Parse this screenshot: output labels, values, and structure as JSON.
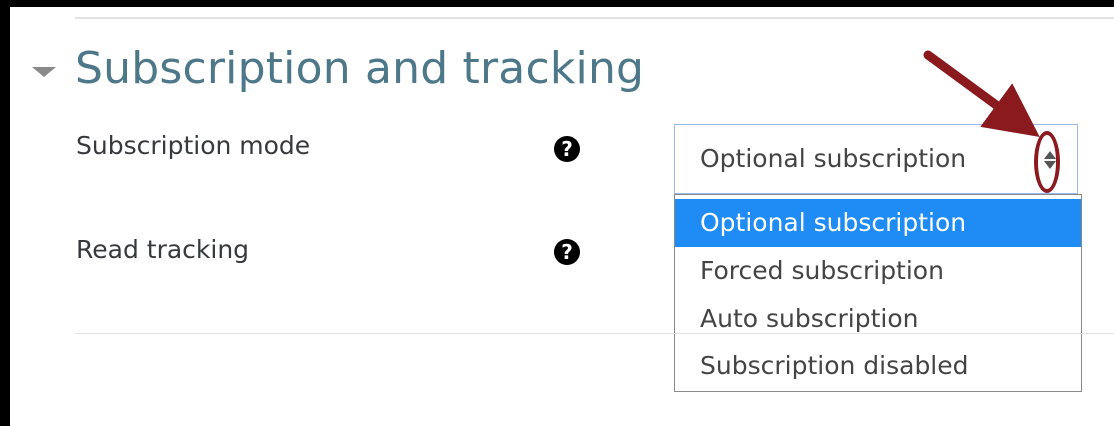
{
  "section": {
    "title": "Subscription and tracking"
  },
  "fields": {
    "subscription_mode": {
      "label": "Subscription mode",
      "selected_value": "Optional subscription",
      "options": [
        "Optional subscription",
        "Forced subscription",
        "Auto subscription",
        "Subscription disabled"
      ],
      "highlighted_index": 0
    },
    "read_tracking": {
      "label": "Read tracking"
    }
  },
  "icons": {
    "collapse": "chevron-down-icon",
    "help": "question-circle-icon",
    "select_spinner": "up-down-arrows-icon",
    "annotation": "red-arrow-annotation"
  },
  "colors": {
    "title": "#4d7889",
    "label": "#373a3c",
    "selected_option_bg": "#1f8cf5",
    "select_border_focus": "#97b9ec",
    "annotation_red": "#8b1a1f"
  }
}
